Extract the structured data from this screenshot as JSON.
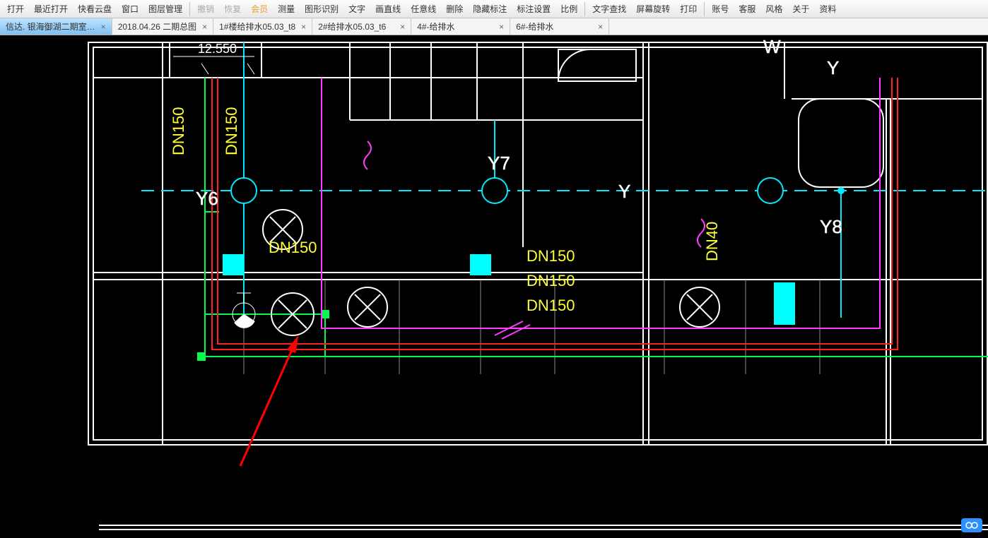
{
  "toolbar": {
    "open": "打开",
    "recent_open": "最近打开",
    "quick_cloud": "快看云盘",
    "window": "窗口",
    "layer_mgmt": "图层管理",
    "undo": "撤销",
    "redo": "恢复",
    "member": "会员",
    "measure": "测量",
    "shape_recognize": "图形识别",
    "text": "文字",
    "draw_line": "画直线",
    "arbitrary_line": "任意线",
    "delete": "删除",
    "hide_annot": "隐藏标注",
    "annot_setting": "标注设置",
    "scale": "比例",
    "find_text": "文字查找",
    "rotate_screen": "屏幕旋转",
    "print": "打印",
    "account": "账号",
    "service": "客服",
    "style": "风格",
    "about": "关于",
    "resource": "资料"
  },
  "tabs": [
    {
      "label": "信达. 银海御湖二期室…",
      "active": true
    },
    {
      "label": "2018.04.26 二期总图",
      "active": false
    },
    {
      "label": "1#楼给排水05.03_t8",
      "active": false
    },
    {
      "label": "2#给排水05.03_t6",
      "active": false
    },
    {
      "label": "4#-给排水",
      "active": false
    },
    {
      "label": "6#-给排水",
      "active": false
    }
  ],
  "drawing_labels": {
    "dim1": "12.550",
    "dn150_a": "DN150",
    "dn150_b": "DN150",
    "dn150_c": "DN150",
    "dn150_d": "DN150",
    "dn150_e": "DN150",
    "dn150_f": "DN150",
    "dn40": "DN40",
    "y6": "Y6",
    "y7": "Y7",
    "y8": "Y8",
    "y": "Y",
    "w": "W",
    "y_side": "Y"
  },
  "badge": "∞"
}
